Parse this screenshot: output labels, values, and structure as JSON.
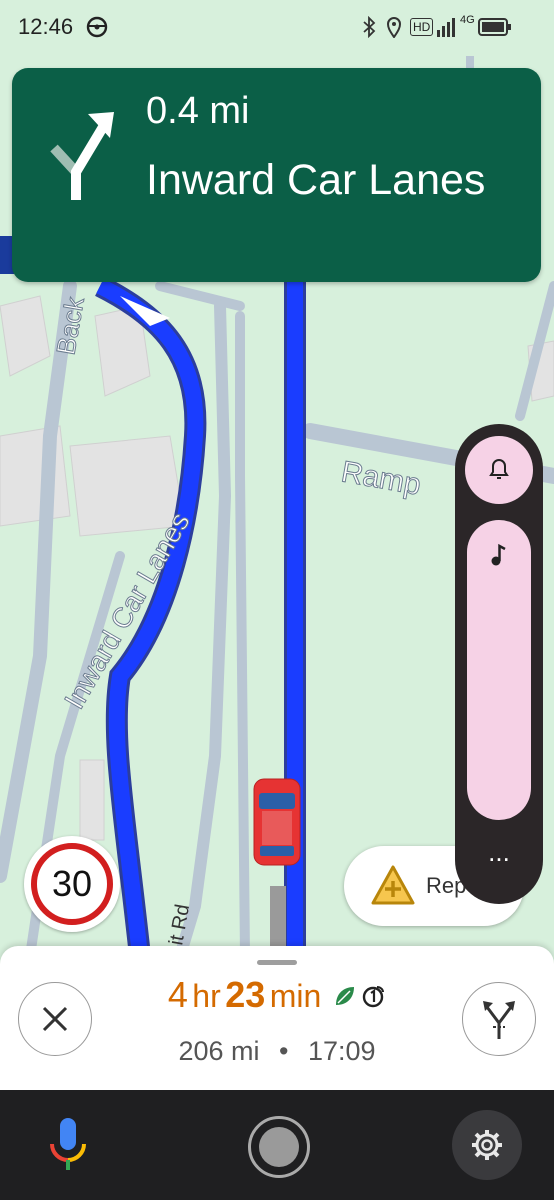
{
  "status_bar": {
    "time": "12:46",
    "icons": [
      "steering-wheel-icon",
      "bluetooth-icon",
      "location-icon",
      "hd-icon",
      "signal-icon",
      "4g-icon",
      "battery-icon"
    ],
    "hd_label": "HD",
    "network_label": "4G"
  },
  "banner": {
    "distance": "0.4 mi",
    "street": "Inward Car Lanes",
    "maneuver_icon": "turn-right-icon",
    "color": "#0b5f47"
  },
  "map": {
    "labels": {
      "inward": "Inward Car Lanes",
      "ramp": "Ramp",
      "back": "Back",
      "rd": "it Rd"
    },
    "route_color": "#1a3dff"
  },
  "speed_limit": {
    "value": "30"
  },
  "report": {
    "label": "Rep",
    "icon": "report-hazard-icon"
  },
  "side_panel": {
    "icons": [
      "bell-icon",
      "music-note-icon",
      "more-icon"
    ],
    "more_label": "..."
  },
  "eta": {
    "hours": "4",
    "hr_label": "hr",
    "minutes": "23",
    "min_label": "min",
    "distance": "206 mi",
    "separator": "•",
    "arrival": "17:09",
    "duration_color": "#d46a00"
  },
  "bottom_nav": {
    "icons": [
      "mic-icon",
      "home-icon",
      "settings-icon"
    ]
  }
}
